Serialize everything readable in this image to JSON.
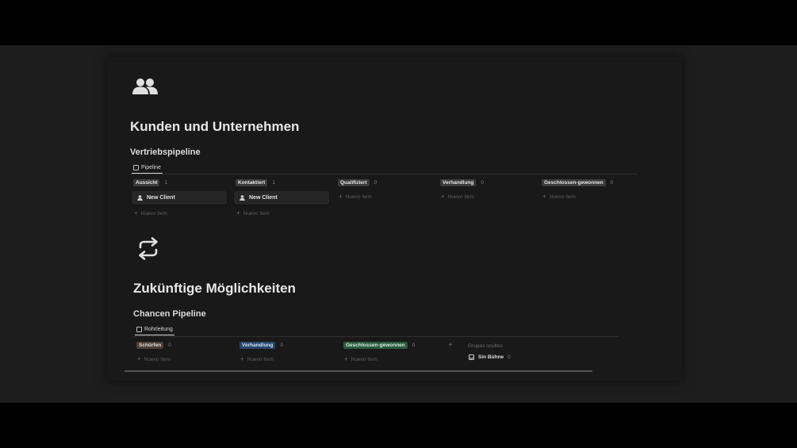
{
  "section1": {
    "title": "Kunden und Unternehmen",
    "icon": "people-icon",
    "db_title": "Vertriebspipeline",
    "view_tab": "Pipeline",
    "columns": [
      {
        "tag": "Aussicht",
        "count": "1",
        "card": "New Client",
        "add": "Nuevo ítem"
      },
      {
        "tag": "Kontaktiert",
        "count": "1",
        "card": "New Client",
        "add": "Nuevo ítem"
      },
      {
        "tag": "Qualifiziert",
        "count": "0",
        "add": "Nuevo ítem"
      },
      {
        "tag": "Verhandlung",
        "count": "0",
        "add": "Nuevo ítem"
      },
      {
        "tag": "Geschlossen-gewonnen",
        "count": "0",
        "add": "Nuevo ítem"
      }
    ]
  },
  "section2": {
    "title": "Zukünftige Möglichkeiten",
    "icon": "repeat-icon",
    "db_title": "Chancen Pipeline",
    "view_tab": "Rohrleitung",
    "columns": [
      {
        "tag": "Schürfen",
        "count": "0",
        "add": "Nuevo ítem",
        "color": "brown"
      },
      {
        "tag": "Verhandlung",
        "count": "0",
        "add": "Nuevo ítem",
        "color": "blue"
      },
      {
        "tag": "Geschlossen-gewonnen",
        "count": "0",
        "add": "Nuevo ítem",
        "color": "green"
      }
    ],
    "add_group": "+",
    "hidden_groups_label": "Grupos ocultos",
    "hidden_group": {
      "label": "Sin Bühne",
      "count": "0"
    }
  },
  "colors": {
    "background": "#191919",
    "blue_tag": "#28456c",
    "green_tag": "#2b593f",
    "brown_tag": "#4a3f39"
  }
}
